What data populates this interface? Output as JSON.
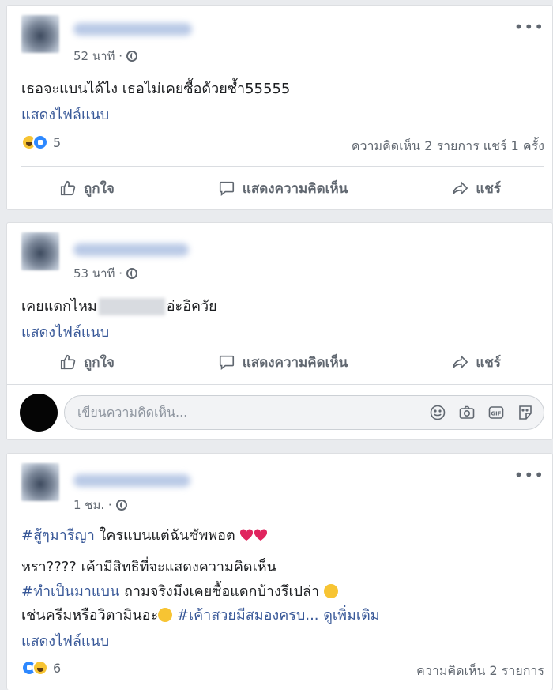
{
  "posts": [
    {
      "time": "52 นาที ·",
      "text": "เธอจะแบนได้ไง เธอไม่เคยซื้อด้วยซ้ำ55555",
      "attachment": "แสดงไฟล์แนบ",
      "reaction_count": "5",
      "stats": "ความคิดเห็น 2 รายการ  แชร์ 1 ครั้ง"
    },
    {
      "time": "53 นาที ·",
      "text_before": "เคยแดกไหม",
      "text_after": "อ่ะอิควัย",
      "attachment": "แสดงไฟล์แนบ",
      "comment_placeholder": "เขียนความคิดเห็น..."
    },
    {
      "time": "1 ชม. ·",
      "line1_hashtag": "#สู้ๆมารีญา",
      "line1_text": " ใครแบนแต่ฉันซัพพอต",
      "line2": "หรา???? เค้ามีสิทธิที่จะแสดงความคิดเห็น",
      "line3_hashtag": "#ทำเป็นมาแบน",
      "line3_text": " ถามจริงมึงเคยซื้อแดกบ้างรึเปล่า",
      "line4_text": "เช่นครีมหรือวิตามินอะ",
      "line4_hashtag": " #เค้าสวยมีสมองครบ",
      "line4_more": "... ดูเพิ่มเติม",
      "attachment": "แสดงไฟล์แนบ",
      "reaction_count": "6",
      "stats": "ความคิดเห็น 2 รายการ"
    }
  ],
  "actions": {
    "like": "ถูกใจ",
    "comment": "แสดงความคิดเห็น",
    "share": "แชร์"
  },
  "more_icon": "•••",
  "colors": {
    "link": "#385898",
    "muted": "#606770",
    "background": "#e9ebee"
  }
}
